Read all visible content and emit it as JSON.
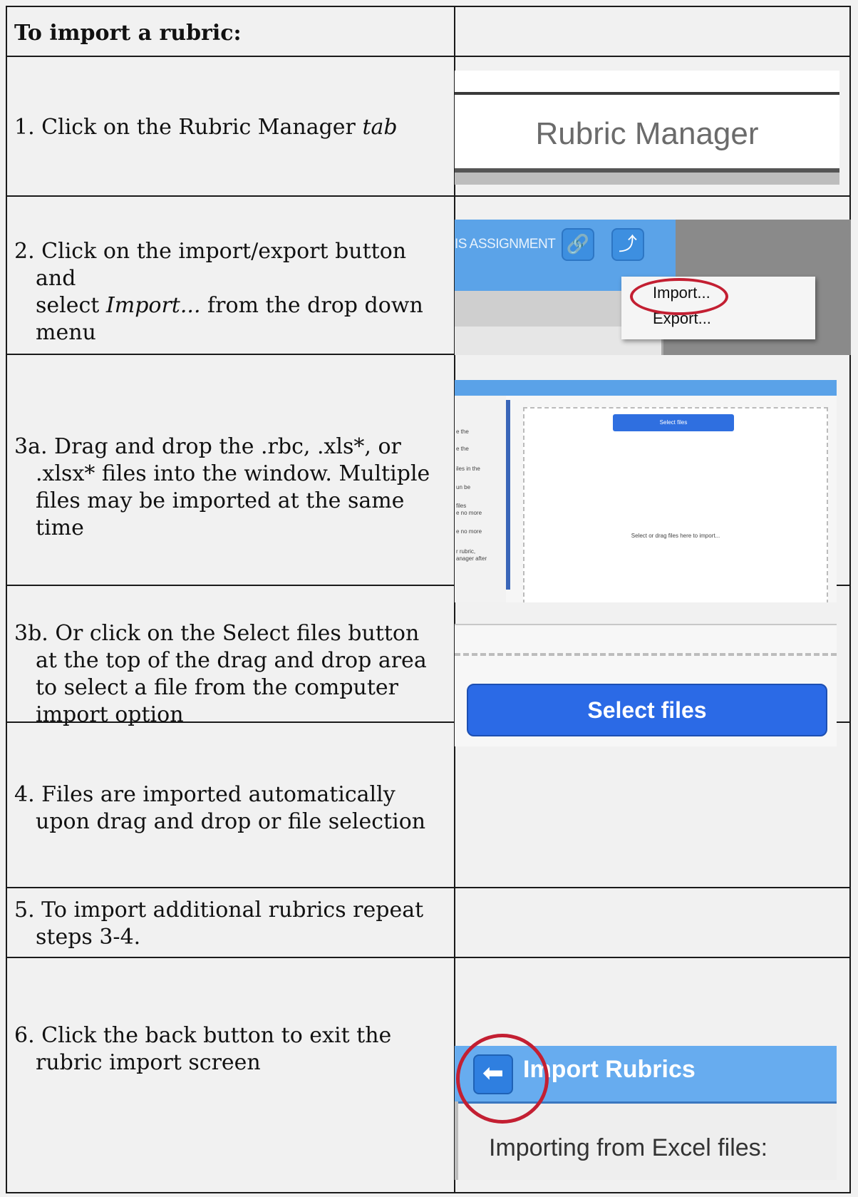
{
  "table": {
    "header": "To import a rubric:",
    "step1": {
      "pre": "1. Click on the Rubric Manager ",
      "em": "tab"
    },
    "step2": {
      "line1": "2. Click on the import/export button and",
      "line2_pre": "select ",
      "line2_em": "Import...",
      "line2_post": " from the drop down",
      "line3": "menu"
    },
    "step3a": "3a. Drag and drop the .rbc, .xls*, or .xlsx* files into the window. Multiple files may be imported at the same time",
    "step3b": "3b. Or click on the Select files button at the top of the drag and drop area to select a file from the computer import option",
    "step4": "4. Files are imported automatically upon drag and drop or file selection",
    "step5": "5. To import additional rubrics repeat steps 3-4.",
    "step6": "6. Click the back button to exit the rubric import screen"
  },
  "shots": {
    "rubric_manager_label": "Rubric Manager",
    "assignment_text": "IS ASSIGNMENT",
    "menu_import": "Import...",
    "menu_export": "Export...",
    "select_files_small": "Select files",
    "drop_hint": "Select or drag files here to import...",
    "side_lines": [
      "e the",
      "e the",
      "",
      "iles in the",
      "",
      "un be",
      "",
      "files",
      "e no more",
      "",
      "e no more",
      "",
      "r rubric,",
      "anager after"
    ],
    "select_files_button": "Select files",
    "import_rubrics_title": "Import Rubrics",
    "importing_from": "Importing from Excel files:"
  },
  "colors": {
    "accent_blue": "#2b6ae6",
    "highlight_red": "#c31f32"
  }
}
